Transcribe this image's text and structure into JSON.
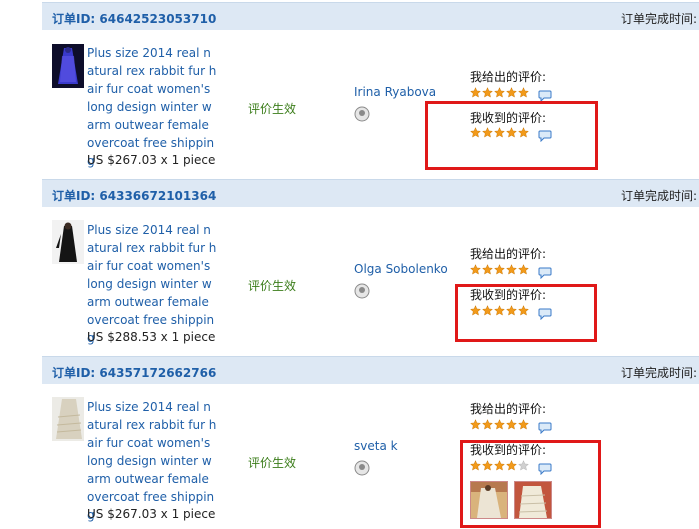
{
  "orders": [
    {
      "id_label": "订单ID: 64642523053710",
      "done_label": "订单完成时间:",
      "product_title": "Plus size 2014 real natural rex rabbit fur hair fur coat women's long design winter warm outwear female overcoat free shipping",
      "price": "US $267.03 x 1 piece",
      "status": "评价生效",
      "buyer": "Irina Ryabova",
      "given_label": "我给出的评价:",
      "given_stars": 5,
      "received_label": "我收到的评价:",
      "received_stars": 5
    },
    {
      "id_label": "订单ID: 64336672101364",
      "done_label": "订单完成时间:",
      "product_title": "Plus size 2014 real natural rex rabbit fur hair fur coat women's long design winter warm outwear female overcoat free shipping",
      "price": "US $288.53 x 1 piece",
      "status": "评价生效",
      "buyer": "Olga Sobolenko",
      "given_label": "我给出的评价:",
      "given_stars": 5,
      "received_label": "我收到的评价:",
      "received_stars": 5
    },
    {
      "id_label": "订单ID: 64357172662766",
      "done_label": "订单完成时间:",
      "product_title": "Plus size 2014 real natural rex rabbit fur hair fur coat women's long design winter warm outwear female overcoat free shipping",
      "price": "US $267.03 x 1 piece",
      "status": "评价生效",
      "buyer": "sveta k",
      "given_label": "我给出的评价:",
      "given_stars": 5,
      "received_label": "我收到的评价:",
      "received_stars": 4
    }
  ],
  "colors": {
    "header_bg": "#dde8f4",
    "link": "#1f5fa8",
    "status": "#3b7d1a",
    "highlight_box": "#e01818",
    "star_on": "#f29a1a",
    "star_off": "#d0d0d0"
  },
  "icons": {
    "comment": "speech-bubble-icon",
    "buyer": "user-badge-icon",
    "star": "star-icon"
  }
}
